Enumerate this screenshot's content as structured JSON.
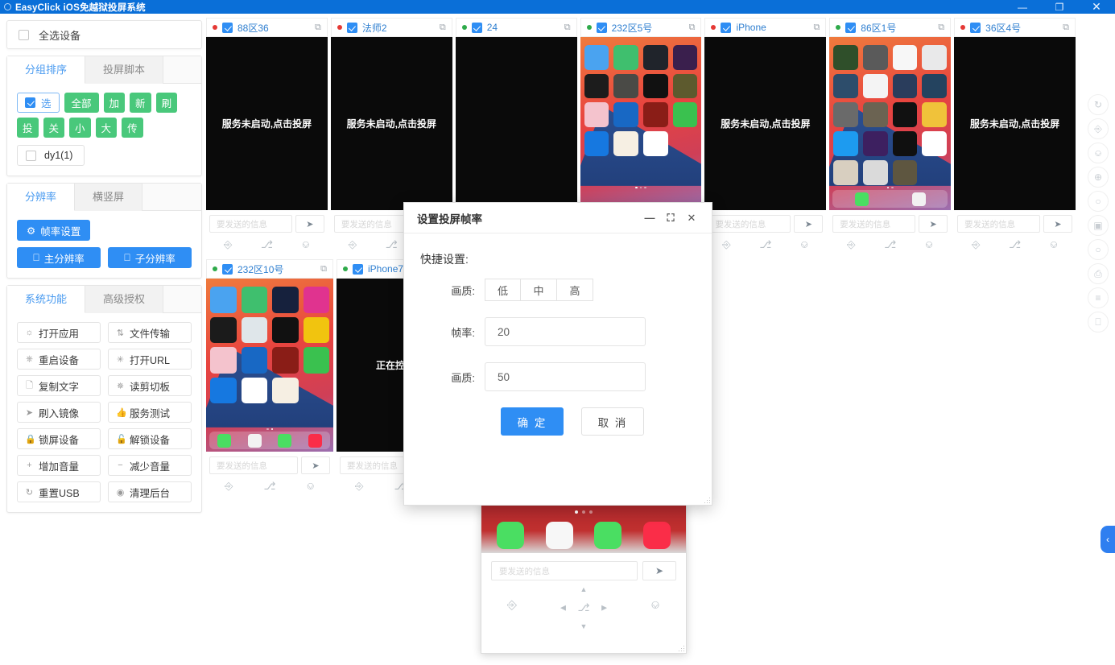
{
  "window": {
    "title": "EasyClick iOS免越狱投屏系统",
    "minimize": "—",
    "maximize": "❐",
    "close": "✕"
  },
  "sidebar": {
    "select_all_label": "全选设备",
    "group_card": {
      "tabs": [
        {
          "label": "分组排序",
          "active": true
        },
        {
          "label": "投屏脚本",
          "active": false
        }
      ],
      "select_toggle": "选",
      "buttons": [
        "全部",
        "加",
        "新",
        "刷",
        "投",
        "关",
        "小",
        "大",
        "传"
      ],
      "group_item": "dy1(1)"
    },
    "resolution_card": {
      "tabs": [
        {
          "label": "分辨率",
          "active": true
        },
        {
          "label": "横竖屏",
          "active": false
        }
      ],
      "frame_rate_button": "帧率设置",
      "main_resolution_button": "主分辨率",
      "sub_resolution_button": "子分辨率"
    },
    "system_card": {
      "tabs": [
        {
          "label": "系统功能",
          "active": true
        },
        {
          "label": "高级授权",
          "active": false
        }
      ],
      "buttons": [
        {
          "icon": "sun-icon",
          "label": "打开应用"
        },
        {
          "icon": "transfer-icon",
          "label": "文件传输"
        },
        {
          "icon": "power-icon",
          "label": "重启设备"
        },
        {
          "icon": "link-icon",
          "label": "打开URL"
        },
        {
          "icon": "file-icon",
          "label": "复制文字"
        },
        {
          "icon": "clipboard-icon",
          "label": "读剪切板"
        },
        {
          "icon": "send-icon",
          "label": "刷入镜像"
        },
        {
          "icon": "thumb-icon",
          "label": "服务测试"
        },
        {
          "icon": "lock-icon",
          "label": "锁屏设备"
        },
        {
          "icon": "unlock-icon",
          "label": "解锁设备"
        },
        {
          "icon": "plus-icon",
          "label": "增加音量"
        },
        {
          "icon": "minus-icon",
          "label": "减少音量"
        },
        {
          "icon": "refresh-icon",
          "label": "重置USB"
        },
        {
          "icon": "target-icon",
          "label": "清理后台"
        }
      ]
    }
  },
  "devices": {
    "not_started_text": "服务未启动,点击投屏",
    "controlling_text": "正在控制中",
    "input_placeholder": "要发送的信息",
    "row1": [
      {
        "name": "88区36",
        "status": "red",
        "checked": true,
        "screen": "message"
      },
      {
        "name": "法师2",
        "status": "red",
        "checked": true,
        "screen": "message"
      },
      {
        "name": "24",
        "status": "green",
        "checked": true,
        "screen": "black"
      },
      {
        "name": "232区5号",
        "status": "green",
        "checked": true,
        "screen": "home"
      },
      {
        "name": "iPhone",
        "status": "red",
        "checked": true,
        "screen": "message"
      },
      {
        "name": "86区1号",
        "status": "green",
        "checked": true,
        "screen": "home"
      },
      {
        "name": "36区4号",
        "status": "red",
        "checked": true,
        "screen": "message"
      }
    ],
    "row2": [
      {
        "name": "232区10号",
        "status": "green",
        "checked": true,
        "screen": "home"
      },
      {
        "name": "iPhone7",
        "status": "green",
        "checked": true,
        "screen": "controlling"
      }
    ]
  },
  "float_window": {
    "input_placeholder": "要发送的信息"
  },
  "modal": {
    "title": "设置投屏帧率",
    "minimize": "—",
    "maximize": "⛶",
    "close": "✕",
    "section_label": "快捷设置:",
    "quality_quick_label": "画质:",
    "quality_options": [
      "低",
      "中",
      "高"
    ],
    "framerate_label": "帧率:",
    "framerate_value": "20",
    "quality_label": "画质:",
    "quality_value": "50",
    "confirm": "确 定",
    "cancel": "取 消"
  },
  "rail": {
    "icons": [
      "refresh-icon",
      "play-icon",
      "pause-icon",
      "zoom-in-icon",
      "zoom-out-icon",
      "layout-icon",
      "search-icon",
      "toggle-icon",
      "sliders-icon",
      "phone-icon"
    ]
  },
  "edge_tab": {
    "label": "‹"
  },
  "colors": {
    "titlebar": "#0a6fd8",
    "accent_blue": "#2f8ef4",
    "accent_green": "#49c87b",
    "link_blue": "#2f7fd0",
    "status_red": "#e53935",
    "status_green": "#2eaa4a"
  }
}
